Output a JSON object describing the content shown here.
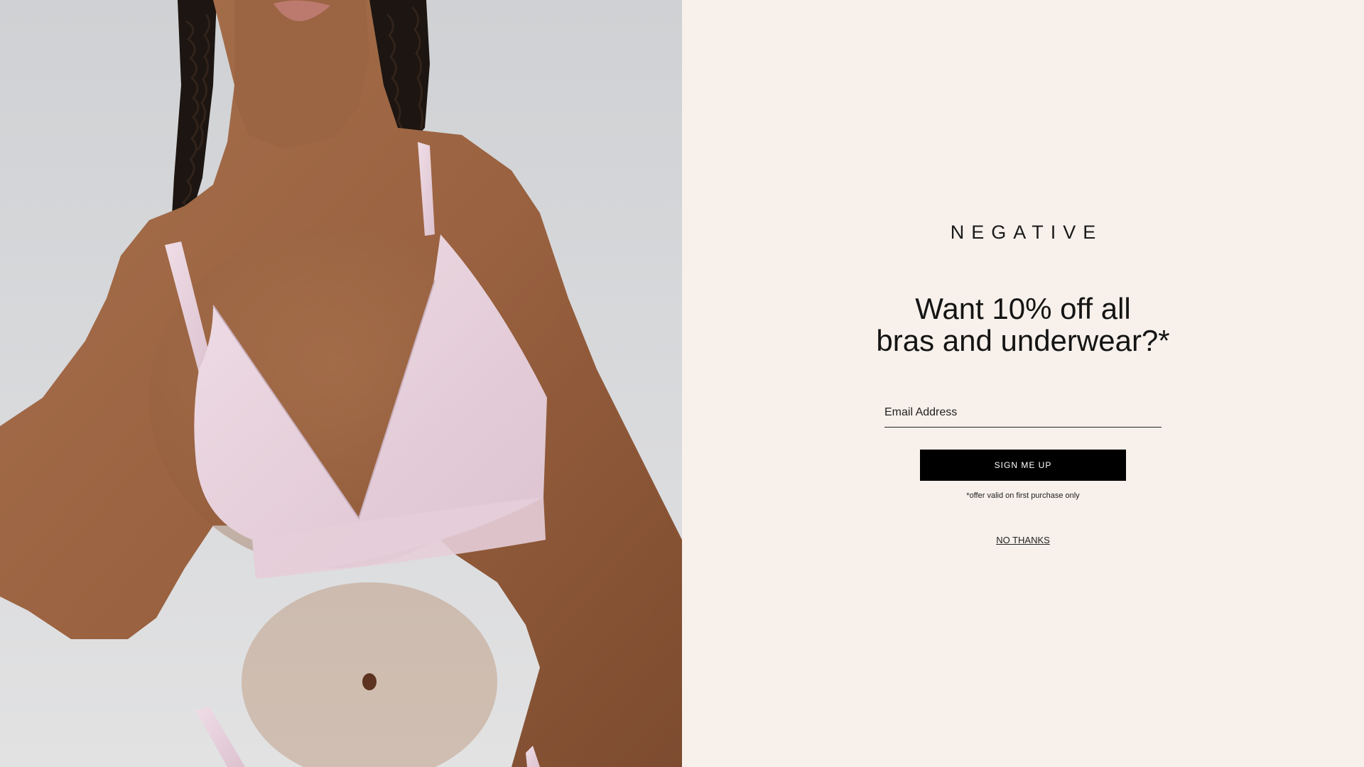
{
  "hero": {
    "image_description_name": "model-photo",
    "background_color": "#d6d7d9",
    "garment_color": "#ecd7e0"
  },
  "form": {
    "brand": "NEGATIVE",
    "headline_line1": "Want 10% off all",
    "headline_line2": "bras and underwear?*",
    "email_placeholder": "Email Address",
    "email_value": "",
    "submit_label": "SIGN ME UP",
    "disclaimer": "*offer valid on first purchase only",
    "dismiss_label": "NO THANKS"
  },
  "colors": {
    "panel_background": "#f7f0eb",
    "button_background": "#000000",
    "button_text": "#ffffff",
    "text": "#141414"
  }
}
